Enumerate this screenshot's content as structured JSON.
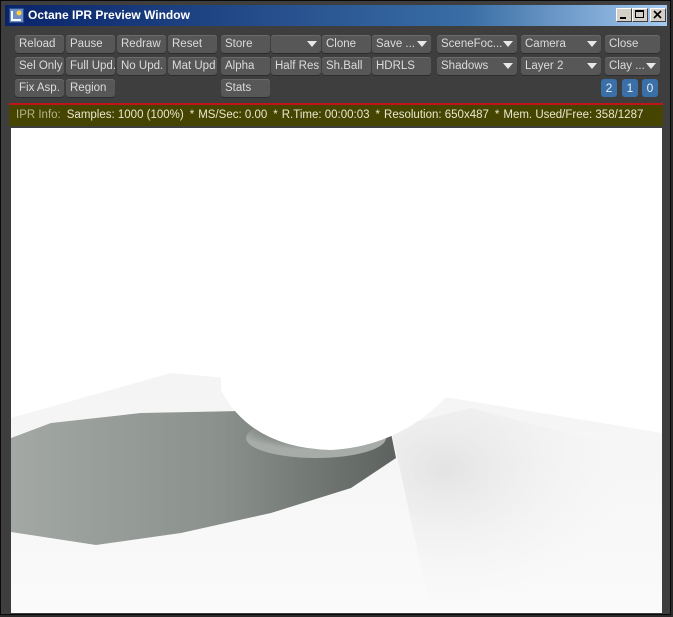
{
  "window": {
    "title": "Octane IPR Preview Window",
    "buttons": {
      "minimize": "minimize",
      "maximize": "maximize",
      "close": "close"
    }
  },
  "toolbar": {
    "row1": {
      "reload": "Reload",
      "pause": "Pause",
      "redraw": "Redraw",
      "reset": "Reset",
      "store": "Store",
      "store_slot": "",
      "clone": "Clone",
      "save": "Save ...",
      "scene_focus": "SceneFoc...",
      "camera": "Camera",
      "close": "Close"
    },
    "row2": {
      "sel_only": "Sel Only",
      "full_upd": "Full Upd.",
      "no_upd": "No Upd.",
      "mat_upd": "Mat Upd",
      "alpha": "Alpha",
      "half_res": "Half Res",
      "sh_ball": "Sh.Ball",
      "hdrls": "HDRLS",
      "shadows": "Shadows",
      "layer": "Layer 2",
      "clay": "Clay ..."
    },
    "row3": {
      "fix_asp": "Fix Asp.",
      "region": "Region",
      "stats": "Stats",
      "counters": [
        "2",
        "1",
        "0"
      ]
    }
  },
  "info": {
    "label": "IPR Info:",
    "samples": "Samples: 1000 (100%)",
    "ms_sec": "MS/Sec: 0.00",
    "r_time": "R.Time: 00:00:03",
    "resolution": "Resolution: 650x487",
    "memory": "Mem. Used/Free: 358/1287",
    "separator": "*"
  },
  "colors": {
    "titlebar_start": "#0a246a",
    "titlebar_end": "#a6caf0",
    "button_bg": "#575757",
    "counter_bg": "#3b6fa8",
    "info_bg": "#454400",
    "progress_red": "#c0141a"
  },
  "icons": {
    "app": "lightwave-icon",
    "dropdown": "chevron-down-icon"
  }
}
